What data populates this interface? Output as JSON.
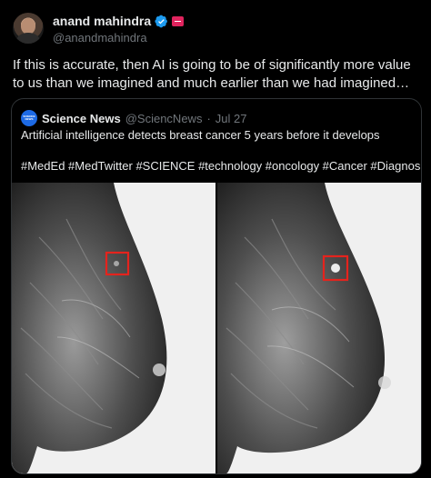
{
  "author": {
    "display_name": "anand mahindra",
    "handle": "@anandmahindra"
  },
  "tweet": {
    "text": "If this is accurate, then AI is going to be of significantly more value to us than we imagined and much earlier than we had imagined…"
  },
  "quoted": {
    "display_name": "Science News",
    "handle": "@SciencNews",
    "separator": "·",
    "date": "Jul 27",
    "text": "Artificial intelligence detects breast cancer 5 years before it develops",
    "hashtags": "#MedEd #MedTwitter #SCIENCE #technology #oncology #Cancer #Diagnosis"
  },
  "colors": {
    "background": "#000000",
    "text": "#e7e9ea",
    "muted": "#71767b",
    "border": "#2f3336",
    "verified": "#1d9bf0",
    "highlight_box": "#e5231d"
  },
  "icons": {
    "verified": "verified-badge-icon",
    "affiliation": "affiliation-flag-icon"
  }
}
